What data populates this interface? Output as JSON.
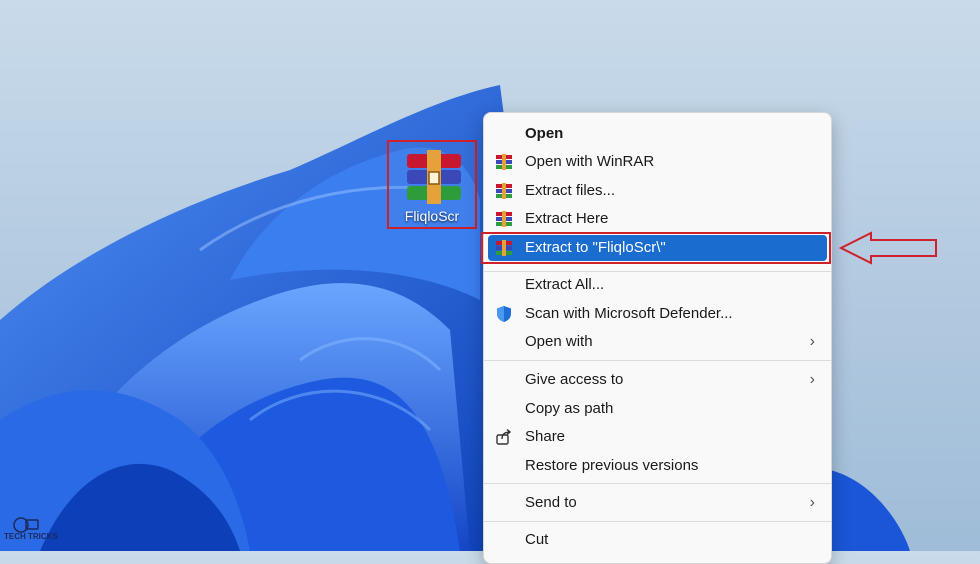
{
  "desktop": {
    "file_icon": "winrar-archive-icon",
    "file_label": "FliqloScr"
  },
  "context_menu": {
    "items": [
      {
        "label": "Open",
        "icon": ""
      },
      {
        "label": "Open with WinRAR",
        "icon": "winrar-icon"
      },
      {
        "label": "Extract files...",
        "icon": "winrar-icon"
      },
      {
        "label": "Extract Here",
        "icon": "winrar-icon"
      },
      {
        "label": "Extract to \"FliqloScr\\\"",
        "icon": "winrar-icon",
        "highlighted": true
      },
      {
        "label": "Extract All...",
        "icon": ""
      },
      {
        "label": "Scan with Microsoft Defender...",
        "icon": "defender-shield-icon"
      },
      {
        "label": "Open with",
        "icon": "",
        "submenu": true
      },
      {
        "label": "Give access to",
        "icon": "",
        "submenu": true
      },
      {
        "label": "Copy as path",
        "icon": ""
      },
      {
        "label": "Share",
        "icon": "share-icon"
      },
      {
        "label": "Restore previous versions",
        "icon": ""
      },
      {
        "label": "Send to",
        "icon": "",
        "submenu": true
      },
      {
        "label": "Cut",
        "icon": ""
      }
    ]
  },
  "watermark": {
    "text": "TECH TRICKS"
  },
  "colors": {
    "highlight": "#1a6ccf",
    "annotation_red": "#d0202a",
    "wallpaper_blue": "#1f63e0"
  }
}
